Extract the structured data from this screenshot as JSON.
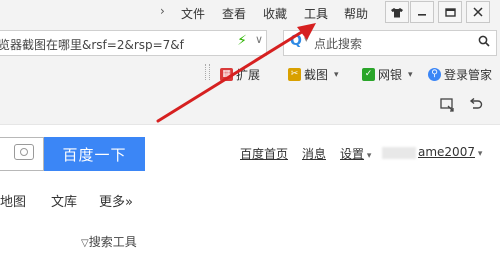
{
  "menubar": {
    "items": [
      "文件",
      "查看",
      "收藏",
      "工具",
      "帮助"
    ],
    "chevron": "›"
  },
  "window_buttons": [
    "shirt-icon",
    "minimize-icon",
    "restore-icon",
    "close-icon"
  ],
  "address_bar": {
    "value": "览器截图在哪里&rsf=2&rsp=7&f",
    "dropdown": "∨"
  },
  "search_bar": {
    "placeholder": "点此搜索"
  },
  "extensions": [
    {
      "label": "扩展",
      "icon": "puzzle-icon",
      "color": "#d93a3a"
    },
    {
      "label": "截图",
      "icon": "scissors-icon",
      "color": "#d9a000"
    },
    {
      "label": "网银",
      "icon": "shield-icon",
      "color": "#2aa52a"
    },
    {
      "label": "登录管家",
      "icon": "key-icon",
      "color": "#3b86f6"
    }
  ],
  "page": {
    "search_button": "百度一下",
    "links": {
      "home": "百度首页",
      "messages": "消息",
      "settings": "设置",
      "user": "ame2007"
    },
    "tabs": [
      "地图",
      "文库",
      "更多»"
    ],
    "search_tools": "搜索工具"
  },
  "colors": {
    "baidu_blue": "#3b86f6",
    "annotation_red": "#d62020",
    "bolt_green": "#2db400"
  }
}
